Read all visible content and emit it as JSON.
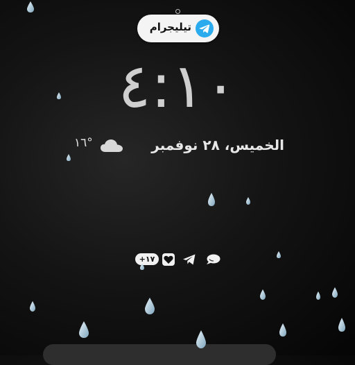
{
  "notification_app": {
    "name": "تيليجرام",
    "icon": "telegram-icon"
  },
  "clock": {
    "time": "٤:١٠"
  },
  "date": {
    "text": "الخميس، ٢٨ نوفمبر"
  },
  "weather": {
    "temperature": "١٦°",
    "icon": "cloud-icon"
  },
  "notifications": {
    "count_badge": "+١٧",
    "icons": [
      "chat-bubble-icon",
      "telegram-send-icon",
      "heart-app-icon"
    ]
  }
}
